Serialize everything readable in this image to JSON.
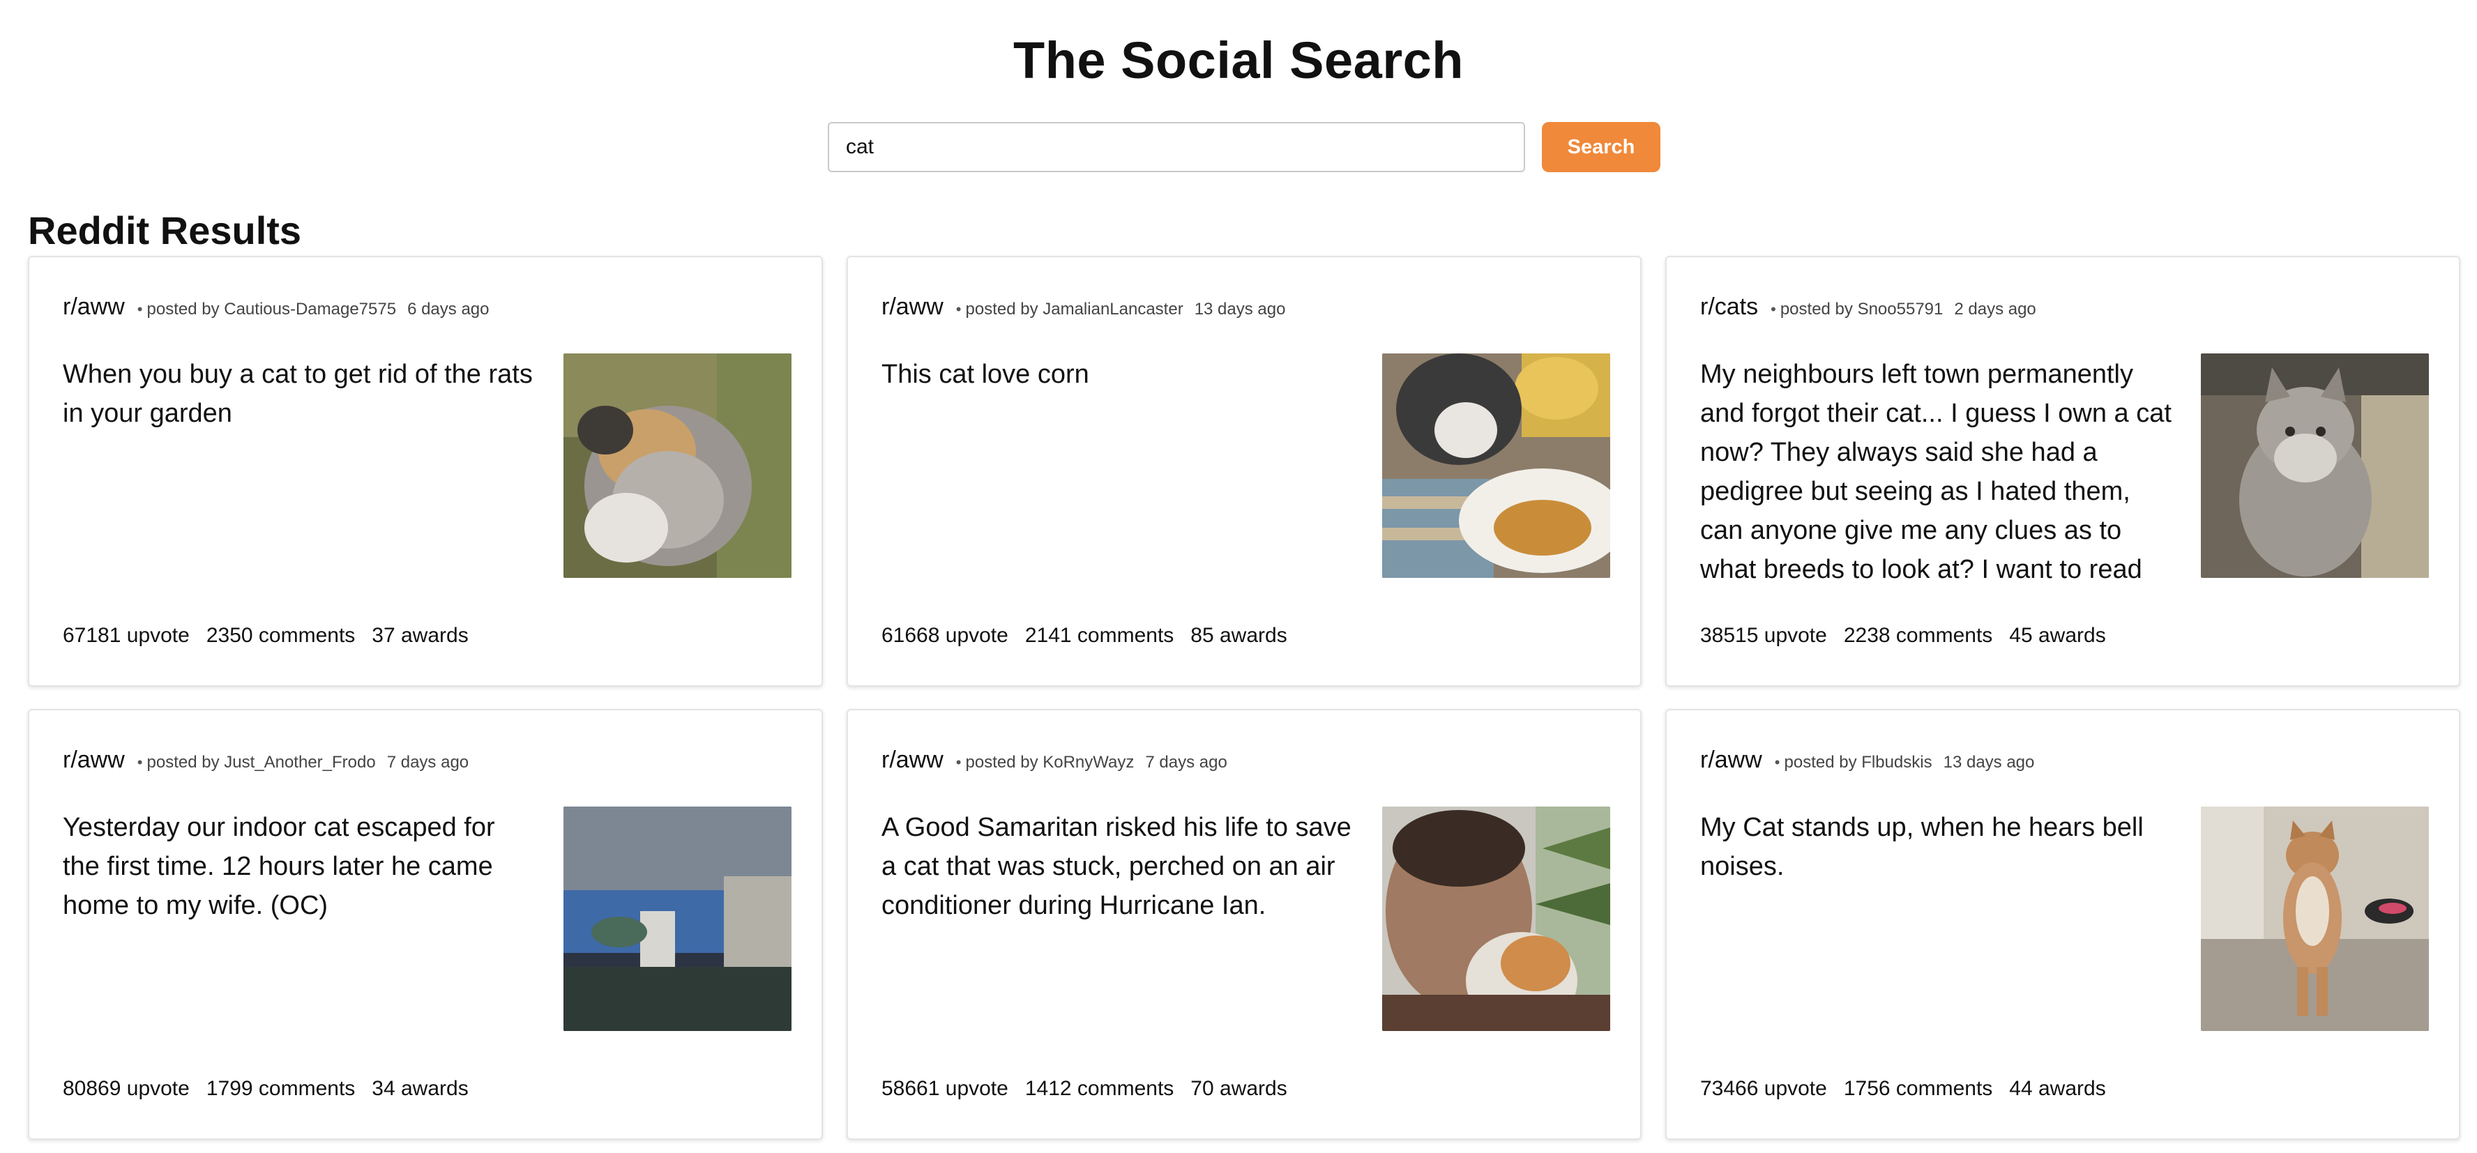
{
  "app": {
    "title": "The Social Search"
  },
  "search": {
    "value": "cat",
    "button_label": "Search"
  },
  "section": {
    "title": "Reddit Results"
  },
  "posts": [
    {
      "subreddit": "r/aww",
      "posted_by": "posted by Cautious-Damage7575",
      "time": "6 days ago",
      "title": "When you buy a cat to get rid of the rats in your garden",
      "upvotes": "67181 upvote",
      "comments": "2350 comments",
      "awards": "37 awards",
      "thumbnail": "fluffy-cat-photo"
    },
    {
      "subreddit": "r/aww",
      "posted_by": "posted by JamalianLancaster",
      "time": "13 days ago",
      "title": "This cat love corn",
      "upvotes": "61668 upvote",
      "comments": "2141 comments",
      "awards": "85 awards",
      "thumbnail": "cat-with-plate-photo"
    },
    {
      "subreddit": "r/cats",
      "posted_by": "posted by Snoo55791",
      "time": "2 days ago",
      "title": "My neighbours left town permanently and forgot their cat... I guess I own a cat now? They always said she had a pedigree but seeing as I hated them, can anyone give me any clues as to what breeds to look at? I want to read up on...",
      "upvotes": "38515 upvote",
      "comments": "2238 comments",
      "awards": "45 awards",
      "thumbnail": "grey-longhair-cat-photo"
    },
    {
      "subreddit": "r/aww",
      "posted_by": "posted by Just_Another_Frodo",
      "time": "7 days ago",
      "title": "Yesterday our indoor cat escaped for the first time. 12 hours later he came home to my wife. (OC)",
      "upvotes": "80869 upvote",
      "comments": "1799 comments",
      "awards": "34 awards",
      "thumbnail": "doorbell-camera-photo"
    },
    {
      "subreddit": "r/aww",
      "posted_by": "posted by KoRnyWayz",
      "time": "7 days ago",
      "title": "A Good Samaritan risked his life to save a cat that was stuck, perched on an air conditioner during Hurricane Ian.",
      "upvotes": "58661 upvote",
      "comments": "1412 comments",
      "awards": "70 awards",
      "thumbnail": "man-holding-cat-photo"
    },
    {
      "subreddit": "r/aww",
      "posted_by": "posted by Flbudskis",
      "time": "13 days ago",
      "title": "My Cat stands up, when he hears bell noises.",
      "upvotes": "73466 upvote",
      "comments": "1756 comments",
      "awards": "44 awards",
      "thumbnail": "standing-cat-photo"
    }
  ],
  "meta_separator": "•"
}
